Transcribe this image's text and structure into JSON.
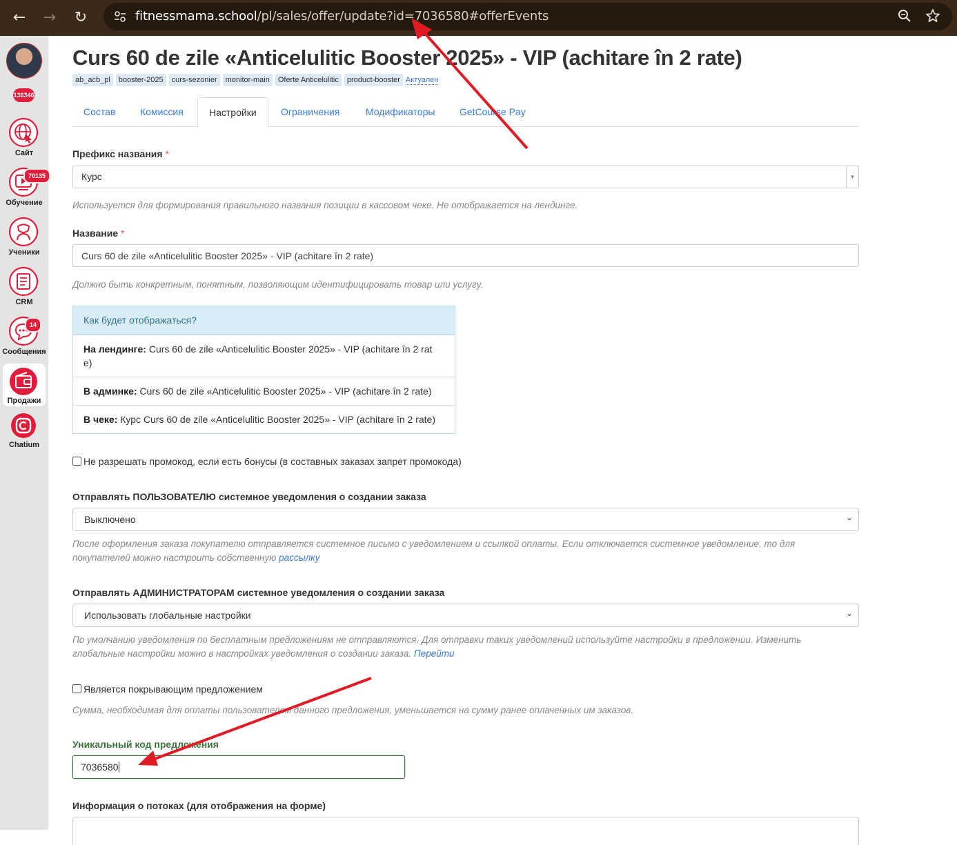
{
  "browser": {
    "url_host": "fitnessmama.school",
    "url_path": "/pl/sales/offer/update?id=7036580#offerEvents"
  },
  "sidebar": {
    "user_id": "136346",
    "items": [
      {
        "label": "Сайт",
        "icon": "globe-icon",
        "badge": ""
      },
      {
        "label": "Обучение",
        "icon": "video-lesson-icon",
        "badge": "70135"
      },
      {
        "label": "Ученики",
        "icon": "student-icon",
        "badge": ""
      },
      {
        "label": "CRM",
        "icon": "crm-icon",
        "badge": ""
      },
      {
        "label": "Сообщения",
        "icon": "chat-icon",
        "badge": "14"
      },
      {
        "label": "Продажи",
        "icon": "wallet-icon",
        "badge": ""
      },
      {
        "label": "Chatium",
        "icon": "chatium-icon",
        "badge": ""
      }
    ]
  },
  "page": {
    "title": "Curs 60 de zile «Anticelulitic Booster 2025» - VIP (achitare în 2 rate)",
    "tags": [
      "ab_acb_pl",
      "booster-2025",
      "curs-sezonier",
      "monitor-main",
      "Oferte Anticelulitic",
      "product-booster"
    ],
    "status_link": "Актуален"
  },
  "tabs": [
    "Состав",
    "Комиссия",
    "Настройки",
    "Ограничения",
    "Модификаторы",
    "GetCourse Pay"
  ],
  "form": {
    "prefix": {
      "label": "Префикс названия",
      "required": "*",
      "value": "Курс",
      "hint": "Используется для формирования правильного названия позиции в кассовом чеке. Не отображается на лендинге."
    },
    "name": {
      "label": "Название",
      "required": "*",
      "value": "Curs 60 de zile «Anticelulitic Booster 2025» - VIP (achitare în 2 rate)",
      "hint": "Должно быть конкретным, понятным, позволяющим идентифицировать товар или услугу."
    },
    "preview": {
      "heading": "Как будет отображаться?",
      "landing_label": "На лендинге:",
      "landing_value": "Curs 60 de zile «Anticelulitic Booster 2025» - VIP (achitare în 2 rat",
      "landing_value_wrap": "e)",
      "admin_label": "В админке:",
      "admin_value": "Curs 60 de zile «Anticelulitic Booster 2025» - VIP (achitare în 2 rate)",
      "receipt_label": "В чеке:",
      "receipt_value": "Курс Curs 60 de zile «Anticelulitic Booster 2025» - VIP (achitare în 2 rate)"
    },
    "no_promo_checkbox": "Не разрешать промокод, если есть бонусы (в составных заказах запрет промокода)",
    "user_notify": {
      "label": "Отправлять ПОЛЬЗОВАТЕЛЮ системное уведомления о создании заказа",
      "value": "Выключено",
      "hint_line1": "После оформления заказа покупателю отправляется системное письмо с уведомлением и ссылкой оплаты. Если отключается системное уведомление, то для",
      "hint_line2": "покупателей можно настроить собственную",
      "hint_link": "рассылку"
    },
    "admin_notify": {
      "label": "Отправлять АДМИНИСТРАТОРАМ системное уведомления о создании заказа",
      "value": "Использовать глобальные настройки",
      "hint_line1": "По умолчанию уведомления по бесплатным предложениям не отправляются. Для отправки таких уведомлений используйте настройки в предложении. Изменить",
      "hint_line2": "глобальные настройки можно в настройках уведомления о создании заказа.",
      "hint_link": "Перейти"
    },
    "covering": {
      "label": "Является покрывающим предложением",
      "hint": "Сумма, необходимая для оплаты пользователем данного предложения, уменьшается на сумму ранее оплаченных им заказов."
    },
    "unique_code": {
      "label": "Уникальный код предложения",
      "value": "7036580"
    },
    "streams_label": "Информация о потоках (для отображения на форме)"
  },
  "colors": {
    "annotation_arrow": "#e01b24",
    "link": "#3a7bd5",
    "brand_red": "#e01e3c"
  }
}
